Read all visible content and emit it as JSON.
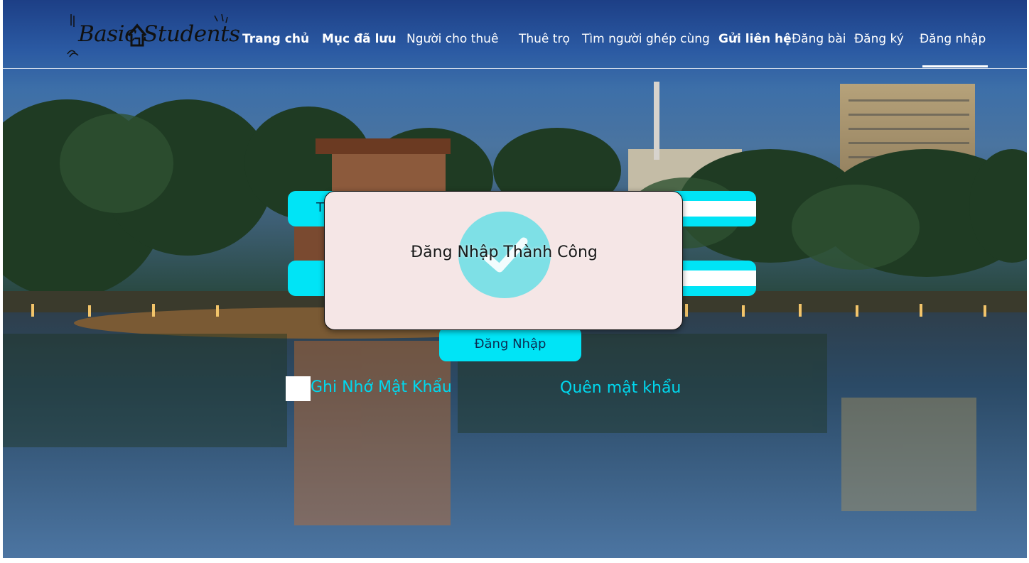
{
  "brand": {
    "logo_text": "Basic Students"
  },
  "nav": {
    "items": [
      {
        "label": "Trang chủ"
      },
      {
        "label": "Mục đã lưu"
      },
      {
        "label": "Người cho thuê"
      },
      {
        "label": "Thuê trọ"
      },
      {
        "label": "Tìm người ghép cùng"
      },
      {
        "label": "Gửi liên hệ"
      },
      {
        "label": "Đăng bài"
      },
      {
        "label": "Đăng ký"
      },
      {
        "label": "Đăng nhập"
      }
    ],
    "active": "Đăng nhập"
  },
  "form": {
    "username_label_partial": "T",
    "login_button": "Đăng Nhập",
    "remember_label": "Ghi Nhớ Mật Khẩu",
    "forgot_label": "Quên mật khẩu"
  },
  "modal": {
    "message": "Đăng Nhập Thành Công"
  },
  "colors": {
    "accent": "#00e4f6",
    "link": "#00d8ee",
    "modal_bg": "#f5e6e6",
    "check": "#7ee0e6"
  },
  "icons": {
    "brand": "house-icon",
    "success": "check-icon"
  }
}
